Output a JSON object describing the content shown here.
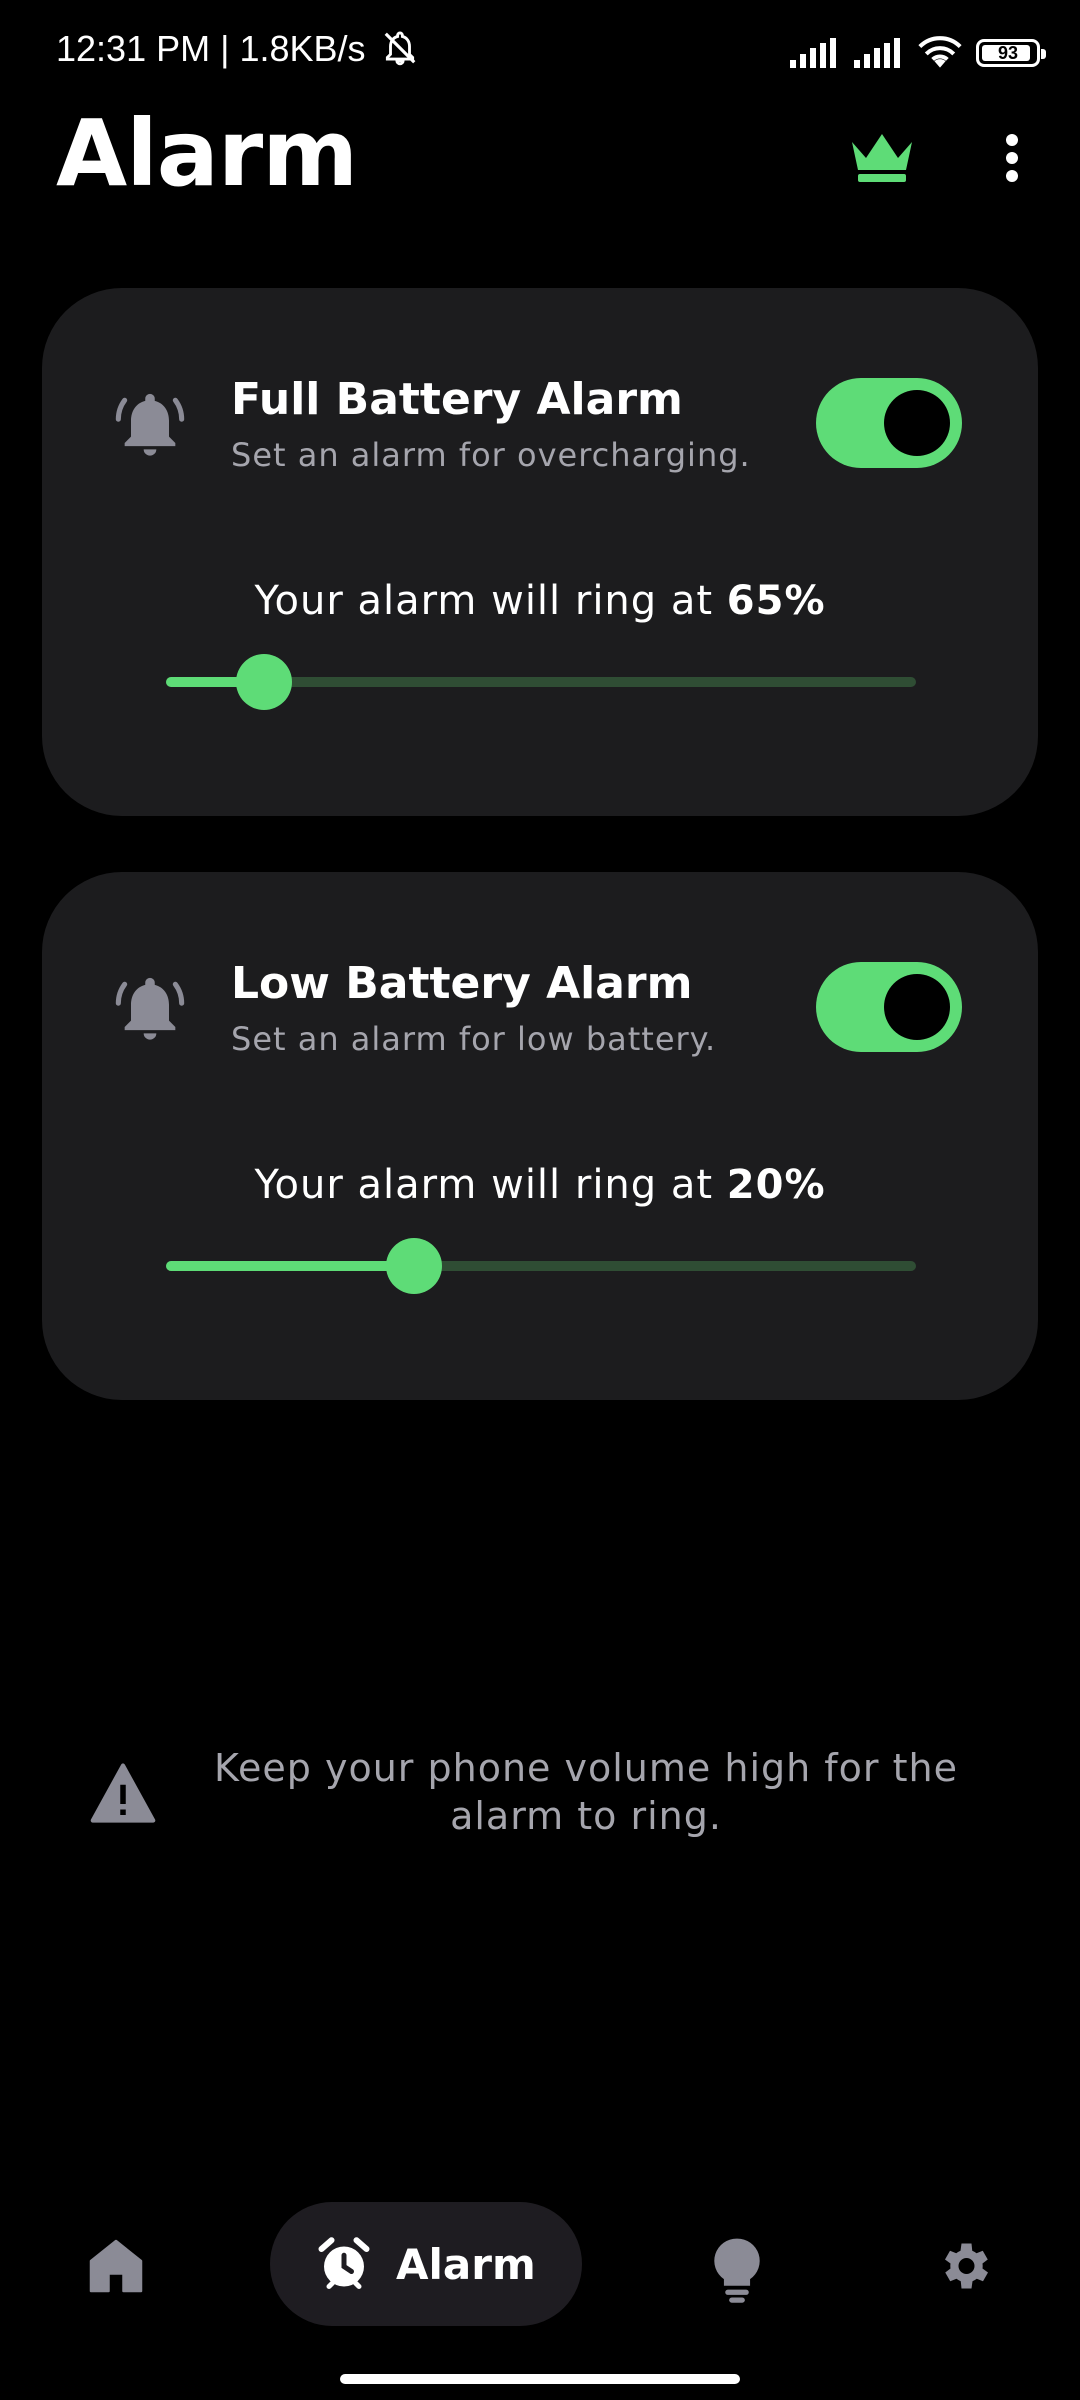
{
  "status_bar": {
    "time_speed": "12:31 PM | 1.8KB/s",
    "battery_level": "93"
  },
  "header": {
    "title": "Alarm",
    "premium_icon": "crown-icon",
    "menu_icon": "more-vert-icon"
  },
  "alarms": [
    {
      "icon": "bell-ring-icon",
      "title": "Full Battery Alarm",
      "subtitle": "Set an alarm for overcharging.",
      "enabled": true,
      "ring_prefix": "Your alarm will ring at ",
      "ring_value": "65%",
      "slider_fraction": 0.13
    },
    {
      "icon": "bell-ring-icon",
      "title": "Low Battery Alarm",
      "subtitle": "Set an alarm for low battery.",
      "enabled": true,
      "ring_prefix": "Your alarm will ring at ",
      "ring_value": "20%",
      "slider_fraction": 0.33
    }
  ],
  "notice": {
    "icon": "warning-icon",
    "text": "Keep your phone volume high for the alarm to ring."
  },
  "bottom_nav": {
    "items": [
      {
        "icon": "home-icon",
        "label": ""
      },
      {
        "icon": "alarm-clock-icon",
        "label": "Alarm",
        "active": true
      },
      {
        "icon": "lightbulb-icon",
        "label": ""
      },
      {
        "icon": "gear-icon",
        "label": ""
      }
    ]
  },
  "colors": {
    "accent": "#5edc77",
    "background": "#000000",
    "card": "#1c1c1e",
    "muted_text": "#a5a5ad",
    "icon_gray": "#8b8b96"
  }
}
